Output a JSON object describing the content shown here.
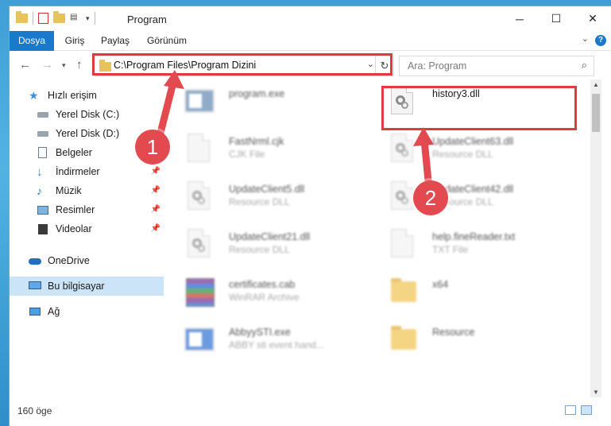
{
  "window": {
    "title": "Program",
    "controls": {
      "minimize": "─",
      "maximize": "☐",
      "close": "✕"
    }
  },
  "ribbon": {
    "tabs": [
      "Dosya",
      "Giriş",
      "Paylaş",
      "Görünüm"
    ],
    "help": "?"
  },
  "nav": {
    "address": "C:\\Program Files\\Program Dizini",
    "search_placeholder": "Ara: Program"
  },
  "sidebar": {
    "items": [
      {
        "label": "Hızlı erişim",
        "icon": "star-icon"
      },
      {
        "label": "Yerel Disk (C:)",
        "icon": "drive-icon"
      },
      {
        "label": "Yerel Disk (D:)",
        "icon": "drive-icon"
      },
      {
        "label": "Belgeler",
        "icon": "documents-icon"
      },
      {
        "label": "İndirmeler",
        "icon": "download-icon",
        "pinned": true
      },
      {
        "label": "Müzik",
        "icon": "music-icon",
        "pinned": true
      },
      {
        "label": "Resimler",
        "icon": "pictures-icon",
        "pinned": true
      },
      {
        "label": "Videolar",
        "icon": "video-icon",
        "pinned": true
      },
      {
        "label": "OneDrive",
        "icon": "cloud-icon"
      },
      {
        "label": "Bu bilgisayar",
        "icon": "computer-icon",
        "selected": true
      },
      {
        "label": "Ağ",
        "icon": "network-icon"
      }
    ]
  },
  "files": [
    {
      "name": "program.exe",
      "type": "",
      "icon": "exe-icon"
    },
    {
      "name": "history3.dll",
      "type": "",
      "icon": "dll-icon"
    },
    {
      "name": "FastNrml.cjk",
      "type": "CJK File",
      "icon": "file-icon"
    },
    {
      "name": "UpdateClient63.dll",
      "type": "Resource DLL",
      "icon": "dll-icon"
    },
    {
      "name": "UpdateClient5.dll",
      "type": "Resource DLL",
      "icon": "dll-icon"
    },
    {
      "name": "UpdateClient42.dll",
      "type": "Resource DLL",
      "icon": "dll-icon"
    },
    {
      "name": "UpdateClient21.dll",
      "type": "Resource DLL",
      "icon": "dll-icon"
    },
    {
      "name": "help.fineReader.txt",
      "type": "TXT File",
      "icon": "file-icon"
    },
    {
      "name": "certificates.cab",
      "type": "WinRAR Archive",
      "icon": "archive-icon"
    },
    {
      "name": "x64",
      "type": "",
      "icon": "folder-icon"
    },
    {
      "name": "AbbyySTI.exe",
      "type": "ABBY sti event hand...",
      "icon": "exe-icon"
    },
    {
      "name": "Resource",
      "type": "",
      "icon": "folder-icon"
    }
  ],
  "status": {
    "count": "160 öge"
  },
  "callouts": [
    "1",
    "2"
  ],
  "colors": {
    "accent": "#1979ca",
    "highlight": "#e0393f",
    "selected": "#cce4f7"
  }
}
